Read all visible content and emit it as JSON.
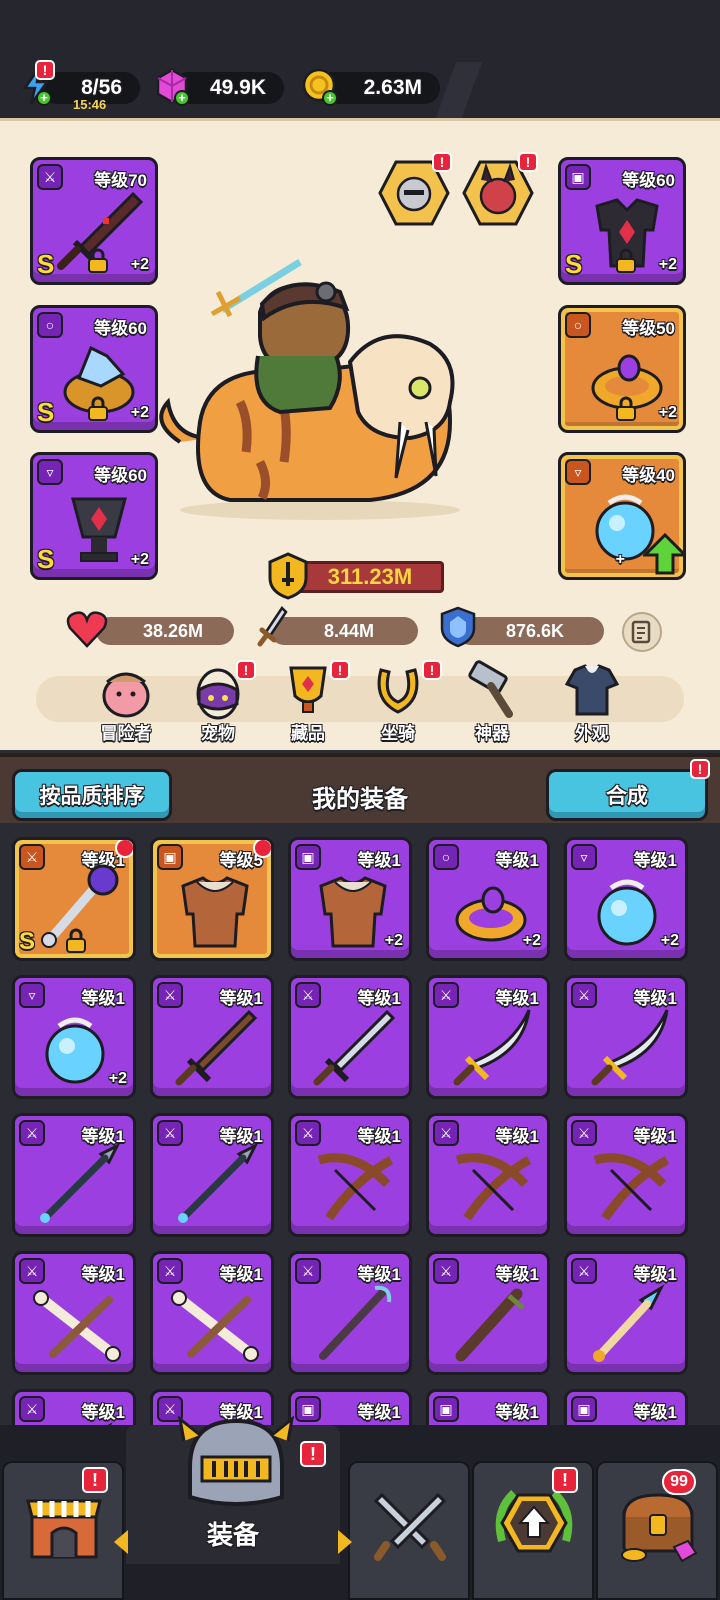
{
  "resources": {
    "energy": {
      "value": "8/56",
      "timer": "15:46"
    },
    "gems": {
      "value": "49.9K"
    },
    "gold": {
      "value": "2.63M"
    }
  },
  "hero": {
    "left_equipment": [
      {
        "level": "等级70",
        "grade": "S",
        "plus": "+2",
        "slot": "weapon"
      },
      {
        "level": "等级60",
        "grade": "S",
        "plus": "+2",
        "slot": "ring"
      },
      {
        "level": "等级60",
        "grade": "S",
        "plus": "+2",
        "slot": "necklace"
      }
    ],
    "right_equipment": [
      {
        "level": "等级60",
        "grade": "S",
        "plus": "+2",
        "slot": "armor"
      },
      {
        "level": "等级50",
        "grade": "",
        "plus": "+2",
        "slot": "ring"
      },
      {
        "level": "等级40",
        "grade": "",
        "plus": "+",
        "slot": "necklace"
      }
    ],
    "power": "311.23M",
    "stats": {
      "hp": "38.26M",
      "attack": "8.44M",
      "defense": "876.6K"
    }
  },
  "nav": [
    {
      "label": "冒险者",
      "alert": false
    },
    {
      "label": "宠物",
      "alert": true
    },
    {
      "label": "藏品",
      "alert": true
    },
    {
      "label": "坐骑",
      "alert": true
    },
    {
      "label": "神器",
      "alert": false
    },
    {
      "label": "外观",
      "alert": false
    }
  ],
  "inventory_header": {
    "sort_label": "按品质排序",
    "title": "我的装备",
    "merge_label": "合成"
  },
  "inventory": [
    {
      "level": "等级1",
      "plus": "",
      "grade": "S",
      "rarity": "orange",
      "slot": "weapon",
      "item": "staff-purple",
      "new": true
    },
    {
      "level": "等级5",
      "plus": "",
      "grade": "",
      "rarity": "orange",
      "slot": "armor",
      "item": "fur-armor",
      "new": true
    },
    {
      "level": "等级1",
      "plus": "+2",
      "grade": "",
      "rarity": "purple",
      "slot": "armor",
      "item": "fur-armor",
      "new": false
    },
    {
      "level": "等级1",
      "plus": "+2",
      "grade": "",
      "rarity": "purple",
      "slot": "ring",
      "item": "gold-ring",
      "new": false
    },
    {
      "level": "等级1",
      "plus": "+2",
      "grade": "",
      "rarity": "purple",
      "slot": "necklace",
      "item": "blue-orb",
      "new": false
    },
    {
      "level": "等级1",
      "plus": "+2",
      "grade": "",
      "rarity": "purple",
      "slot": "necklace",
      "item": "blue-orb",
      "new": false
    },
    {
      "level": "等级1",
      "plus": "",
      "grade": "",
      "rarity": "purple",
      "slot": "weapon",
      "item": "wood-sword",
      "new": false
    },
    {
      "level": "等级1",
      "plus": "",
      "grade": "",
      "rarity": "purple",
      "slot": "weapon",
      "item": "steel-sword",
      "new": false
    },
    {
      "level": "等级1",
      "plus": "",
      "grade": "",
      "rarity": "purple",
      "slot": "weapon",
      "item": "scimitar",
      "new": false
    },
    {
      "level": "等级1",
      "plus": "",
      "grade": "",
      "rarity": "purple",
      "slot": "weapon",
      "item": "scimitar",
      "new": false
    },
    {
      "level": "等级1",
      "plus": "",
      "grade": "",
      "rarity": "purple",
      "slot": "weapon",
      "item": "spear",
      "new": false
    },
    {
      "level": "等级1",
      "plus": "",
      "grade": "",
      "rarity": "purple",
      "slot": "weapon",
      "item": "spear",
      "new": false
    },
    {
      "level": "等级1",
      "plus": "",
      "grade": "",
      "rarity": "purple",
      "slot": "weapon",
      "item": "bow",
      "new": false
    },
    {
      "level": "等级1",
      "plus": "",
      "grade": "",
      "rarity": "purple",
      "slot": "weapon",
      "item": "bow",
      "new": false
    },
    {
      "level": "等级1",
      "plus": "",
      "grade": "",
      "rarity": "purple",
      "slot": "weapon",
      "item": "bow",
      "new": false
    },
    {
      "level": "等级1",
      "plus": "",
      "grade": "",
      "rarity": "purple",
      "slot": "weapon",
      "item": "bone-crossbow",
      "new": false
    },
    {
      "level": "等级1",
      "plus": "",
      "grade": "",
      "rarity": "purple",
      "slot": "weapon",
      "item": "bone-crossbow",
      "new": false
    },
    {
      "level": "等级1",
      "plus": "",
      "grade": "",
      "rarity": "purple",
      "slot": "weapon",
      "item": "wand",
      "new": false
    },
    {
      "level": "等级1",
      "plus": "",
      "grade": "",
      "rarity": "purple",
      "slot": "weapon",
      "item": "club",
      "new": false
    },
    {
      "level": "等级1",
      "plus": "",
      "grade": "",
      "rarity": "purple",
      "slot": "weapon",
      "item": "crystal-staff",
      "new": false
    },
    {
      "level": "等级1",
      "plus": "",
      "grade": "",
      "rarity": "purple",
      "slot": "weapon",
      "item": "crystal-staff",
      "new": false
    },
    {
      "level": "等级1",
      "plus": "",
      "grade": "",
      "rarity": "purple",
      "slot": "weapon",
      "item": "crystal-staff",
      "new": false
    },
    {
      "level": "等级1",
      "plus": "",
      "grade": "",
      "rarity": "purple",
      "slot": "armor",
      "item": "fur-armor",
      "new": false
    },
    {
      "level": "等级1",
      "plus": "",
      "grade": "",
      "rarity": "purple",
      "slot": "armor",
      "item": "fur-armor",
      "new": false
    },
    {
      "level": "等级1",
      "plus": "",
      "grade": "",
      "rarity": "purple",
      "slot": "armor",
      "item": "fur-armor",
      "new": false
    }
  ],
  "tabs": {
    "active_label": "装备",
    "chest_count": "99"
  },
  "colors": {
    "purple_card": "#9b3fe0",
    "orange_card": "#e48a3a",
    "accent_blue": "#48c4e0",
    "alert_red": "#e8243b",
    "gold_text": "#ffd63f"
  }
}
